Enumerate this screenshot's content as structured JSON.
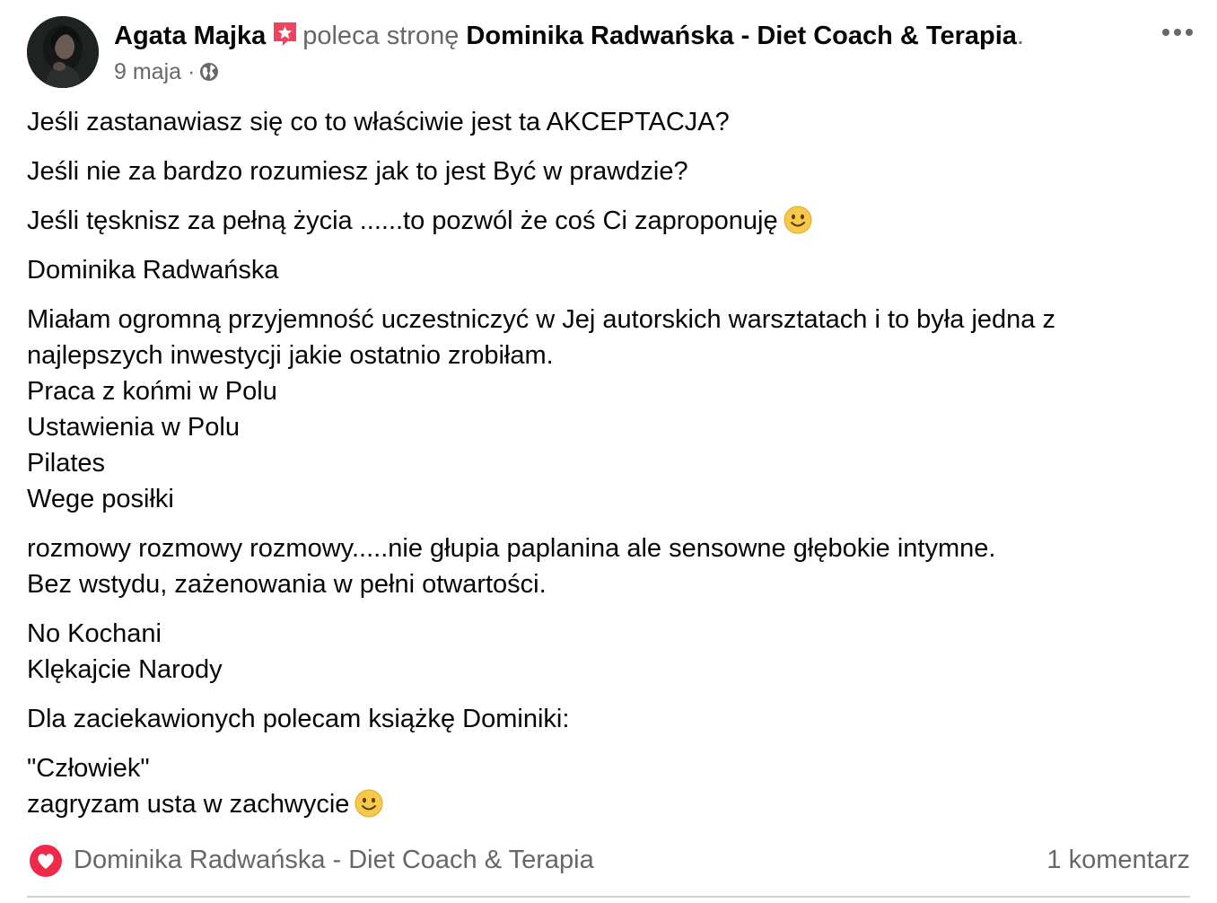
{
  "post": {
    "author_name": "Agata Majka",
    "action_text": "poleca stronę",
    "page_name": "Dominika Radwańska - Diet Coach & Terapia",
    "title_end": ".",
    "date": "9 maja",
    "date_separator": "·",
    "privacy_icon": "globe-icon",
    "more_icon": "more-options-icon",
    "badge_icon": "recommend-star-badge-icon"
  },
  "content": {
    "paragraphs": [
      {
        "lines": [
          "Jeśli zastanawiasz się  co to właściwie jest ta AKCEPTACJA?"
        ]
      },
      {
        "lines": [
          "Jeśli nie za bardzo rozumiesz jak to jest Być w prawdzie?"
        ]
      },
      {
        "lines": [
          "Jeśli tęsknisz za pełną życia ......to pozwól że coś Ci zaproponuję"
        ],
        "emoji": "slightly-smiling-face"
      },
      {
        "lines": [
          "Dominika Radwańska"
        ]
      },
      {
        "lines": [
          "Miałam ogromną przyjemność uczestniczyć w Jej autorskich warsztatach i to była jedna z",
          "najlepszych inwestycji jakie ostatnio zrobiłam.",
          "Praca z końmi w Polu",
          "Ustawienia w Polu",
          "Pilates",
          "Wege posiłki"
        ]
      },
      {
        "lines": [
          "rozmowy rozmowy rozmowy.....nie głupia paplanina ale sensowne głębokie intymne.",
          "Bez wstydu, zażenowania w pełni otwartości."
        ]
      },
      {
        "lines": [
          "No Kochani",
          "Klękajcie Narody"
        ]
      },
      {
        "lines": [
          "Dla zaciekawionych polecam książkę Dominiki:"
        ]
      },
      {
        "lines": [
          "\"Człowiek\"",
          "zagryzam usta w zachwycie"
        ],
        "emoji": "slightly-smiling-face"
      }
    ]
  },
  "footer": {
    "recommend_icon": "heart-recommend-icon",
    "page_name": "Dominika Radwańska - Diet Coach & Terapia",
    "comments": "1 komentarz"
  },
  "colors": {
    "text_primary": "#050505",
    "text_secondary": "#65676b",
    "recommend_red": "#f02849",
    "badge_pink": "#f3425f",
    "emoji_yellow": "#f7c948",
    "divider": "#ced0d4"
  }
}
